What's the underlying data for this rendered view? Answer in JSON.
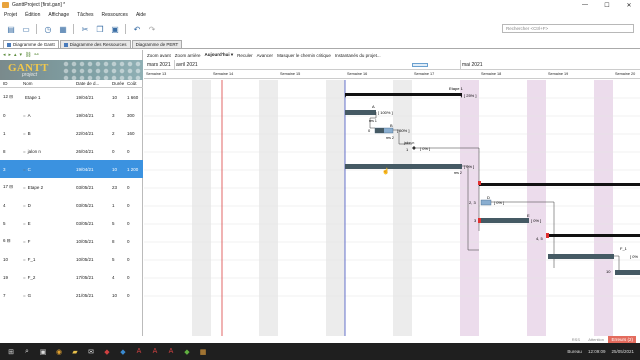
{
  "window": {
    "title": "GanttProject [first.gan] *",
    "controls": [
      "—",
      "☐",
      "✕"
    ]
  },
  "menu": [
    "Projet",
    "Édition",
    "Affichage",
    "Tâches",
    "Ressources",
    "Aide"
  ],
  "toolbar": {
    "search_placeholder": "Rechercher <Ctrl+F>"
  },
  "tabs": [
    {
      "label": "Diagramme de Gantt"
    },
    {
      "label": "Diagramme des Ressources"
    },
    {
      "label": "Diagramme de PERT"
    }
  ],
  "logo": {
    "title": "GANTT",
    "subtitle": "project"
  },
  "table": {
    "headers": {
      "id": "ID",
      "nom": "Nom",
      "date": "Date de d...",
      "duree": "Durée",
      "cout": "Coût"
    },
    "rows": [
      {
        "id": "12",
        "tree": "⊟",
        "bullet": "",
        "nom": "Etape 1",
        "date": "19/04/21",
        "duree": "10",
        "cout": "1 660"
      },
      {
        "id": "0",
        "tree": "",
        "bullet": "=",
        "nom": "A",
        "date": "19/04/21",
        "duree": "3",
        "cout": "300"
      },
      {
        "id": "1",
        "tree": "",
        "bullet": "=",
        "nom": "B",
        "date": "22/04/21",
        "duree": "2",
        "cout": "160"
      },
      {
        "id": "8",
        "tree": "",
        "bullet": "=",
        "nom": "jalon n",
        "date": "26/04/21",
        "duree": "0",
        "cout": "0"
      },
      {
        "id": "3",
        "tree": "",
        "bullet": "=",
        "nom": "C",
        "date": "19/04/21",
        "duree": "10",
        "cout": "1 200"
      },
      {
        "id": "17",
        "tree": "⊟",
        "bullet": "=",
        "nom": "Etape 2",
        "date": "03/05/21",
        "duree": "23",
        "cout": "0"
      },
      {
        "id": "4",
        "tree": "",
        "bullet": "=",
        "nom": "D",
        "date": "03/05/21",
        "duree": "1",
        "cout": "0"
      },
      {
        "id": "5",
        "tree": "",
        "bullet": "=",
        "nom": "E",
        "date": "03/05/21",
        "duree": "5",
        "cout": "0"
      },
      {
        "id": "6",
        "tree": "⊟",
        "bullet": "=",
        "nom": "F",
        "date": "10/05/21",
        "duree": "8",
        "cout": "0"
      },
      {
        "id": "10",
        "tree": "",
        "bullet": "=",
        "nom": "F_1",
        "date": "10/05/21",
        "duree": "5",
        "cout": "0"
      },
      {
        "id": "19",
        "tree": "",
        "bullet": "=",
        "nom": "F_2",
        "date": "17/05/21",
        "duree": "4",
        "cout": "0"
      },
      {
        "id": "7",
        "tree": "",
        "bullet": "=",
        "nom": "G",
        "date": "21/05/21",
        "duree": "10",
        "cout": "0"
      }
    ],
    "selected_row": 4
  },
  "chart_toolbar": [
    "Zoom avant",
    "Zoom arrière",
    "Aujourd'hui ▾",
    "Reculer",
    "Avancer",
    "Masquer le chemin critique",
    "Instantanés du projet..."
  ],
  "months": [
    "mars 2021",
    "avril 2021",
    "mai 2021"
  ],
  "weeks": [
    "Semaine 13",
    "Semaine 14",
    "Semaine 15",
    "Semaine 16",
    "Semaine 17",
    "Semaine 18",
    "Semaine 19",
    "Semaine 20"
  ],
  "gantt_labels": {
    "etape1": "Etape 1",
    "etape1_pct": "[ 25% ]",
    "a_name": "A",
    "a_pct": "[ 100% ]",
    "a_res": "res 1",
    "b_name": "B",
    "b_pred": "0",
    "b_pct": "[ 50% ]",
    "b_res": "res 2",
    "jalon_name": "jalon n",
    "jalon_pred": "1",
    "jalon_pct": "[ 0% ]",
    "c_pct": "[ 0% ]",
    "c_res": "res 2",
    "d_name": "D",
    "d_pred": "2, 3",
    "d_pct": "[ 0% ]",
    "e_name": "E",
    "e_pred": "3",
    "e_pct": "[ 0% ]",
    "f_pred": "4, 5",
    "f1_name": "F_1",
    "f1_pct": "[ 0%",
    "f2_pred": "10"
  },
  "statusbar": {
    "rss": "RSS",
    "attention": "Attention",
    "errors": "Erreurs (2)"
  },
  "taskbar": {
    "time": "12:09:09",
    "date": "25/05/2021",
    "bureau": "Bureau"
  }
}
